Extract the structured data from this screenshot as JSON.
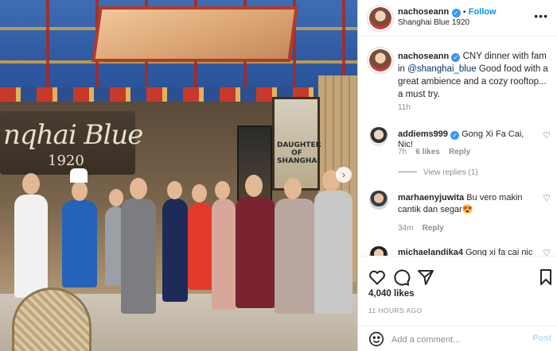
{
  "photo": {
    "sign_text": "nqhai Blue",
    "sign_year": "1920",
    "poster_text": "DAUGHTER OF SHANGHAI",
    "next_icon": "chevron-right-icon"
  },
  "header": {
    "username": "nachoseann",
    "follow_label": "Follow",
    "separator": "•",
    "location": "Shanghai Blue 1920",
    "more_icon": "more-horizontal-icon"
  },
  "caption": {
    "username": "nachoseann",
    "text_before_mention": "CNY dinner with fam in",
    "mention": "@shanghai_blue",
    "text_after_mention": "Good food with a great ambience and a cozy rooftop... a must try.",
    "age": "11h"
  },
  "comments": [
    {
      "username": "addiems999",
      "verified": true,
      "text": "Gong Xi Fa Cai, Nic!",
      "age": "7h",
      "likes": "6 likes",
      "reply": "Reply",
      "view_replies": "View replies (1)"
    },
    {
      "username": "marhaenyjuwita",
      "verified": false,
      "text": "Bu vero makin cantik dan segar😍",
      "age": "34m",
      "reply": "Reply"
    },
    {
      "username": "michaelandika4",
      "verified": false,
      "text": "Gong xi fa cai nic"
    }
  ],
  "actions": {
    "like_icon": "heart-icon",
    "comment_icon": "comment-icon",
    "share_icon": "send-icon",
    "save_icon": "bookmark-icon"
  },
  "likes": "4,040 likes",
  "timestamp": "11 HOURS AGO",
  "comment_box": {
    "emoji_icon": "emoji-icon",
    "placeholder": "Add a comment...",
    "post_label": "Post"
  },
  "colors": {
    "accent": "#0095f6",
    "verified": "#3897f0",
    "post_disabled": "#b3dbff"
  }
}
